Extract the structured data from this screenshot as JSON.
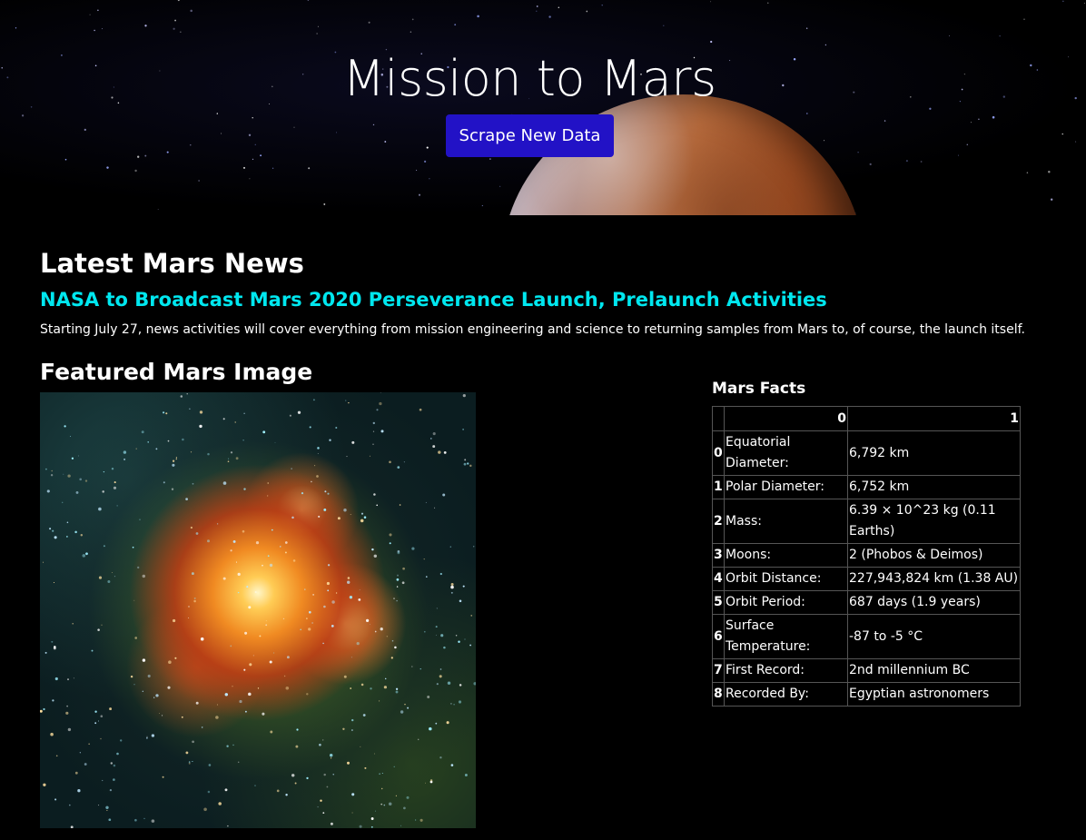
{
  "hero": {
    "title": "Mission to Mars",
    "scrape_button": "Scrape New Data",
    "button_color": "#2212c6"
  },
  "news": {
    "heading": "Latest Mars News",
    "title": "NASA to Broadcast Mars 2020 Perseverance Launch, Prelaunch Activities",
    "teaser": "Starting July 27, news activities will cover everything from mission engineering and science to returning samples from Mars to, of course, the launch itself.",
    "title_color": "#00e7ef"
  },
  "featured": {
    "heading": "Featured Mars Image"
  },
  "facts": {
    "heading": "Mars Facts",
    "columns": [
      "",
      "0",
      "1"
    ],
    "rows": [
      {
        "index": "0",
        "label": "Equatorial Diameter:",
        "value": "6,792 km"
      },
      {
        "index": "1",
        "label": "Polar Diameter:",
        "value": "6,752 km"
      },
      {
        "index": "2",
        "label": "Mass:",
        "value": "6.39 × 10^23 kg (0.11 Earths)"
      },
      {
        "index": "3",
        "label": "Moons:",
        "value": "2 (Phobos & Deimos)"
      },
      {
        "index": "4",
        "label": "Orbit Distance:",
        "value": "227,943,824 km (1.38 AU)"
      },
      {
        "index": "5",
        "label": "Orbit Period:",
        "value": "687 days (1.9 years)"
      },
      {
        "index": "6",
        "label": "Surface Temperature:",
        "value": "-87 to -5 °C"
      },
      {
        "index": "7",
        "label": "First Record:",
        "value": "2nd millennium BC"
      },
      {
        "index": "8",
        "label": "Recorded By:",
        "value": "Egyptian astronomers"
      }
    ]
  }
}
